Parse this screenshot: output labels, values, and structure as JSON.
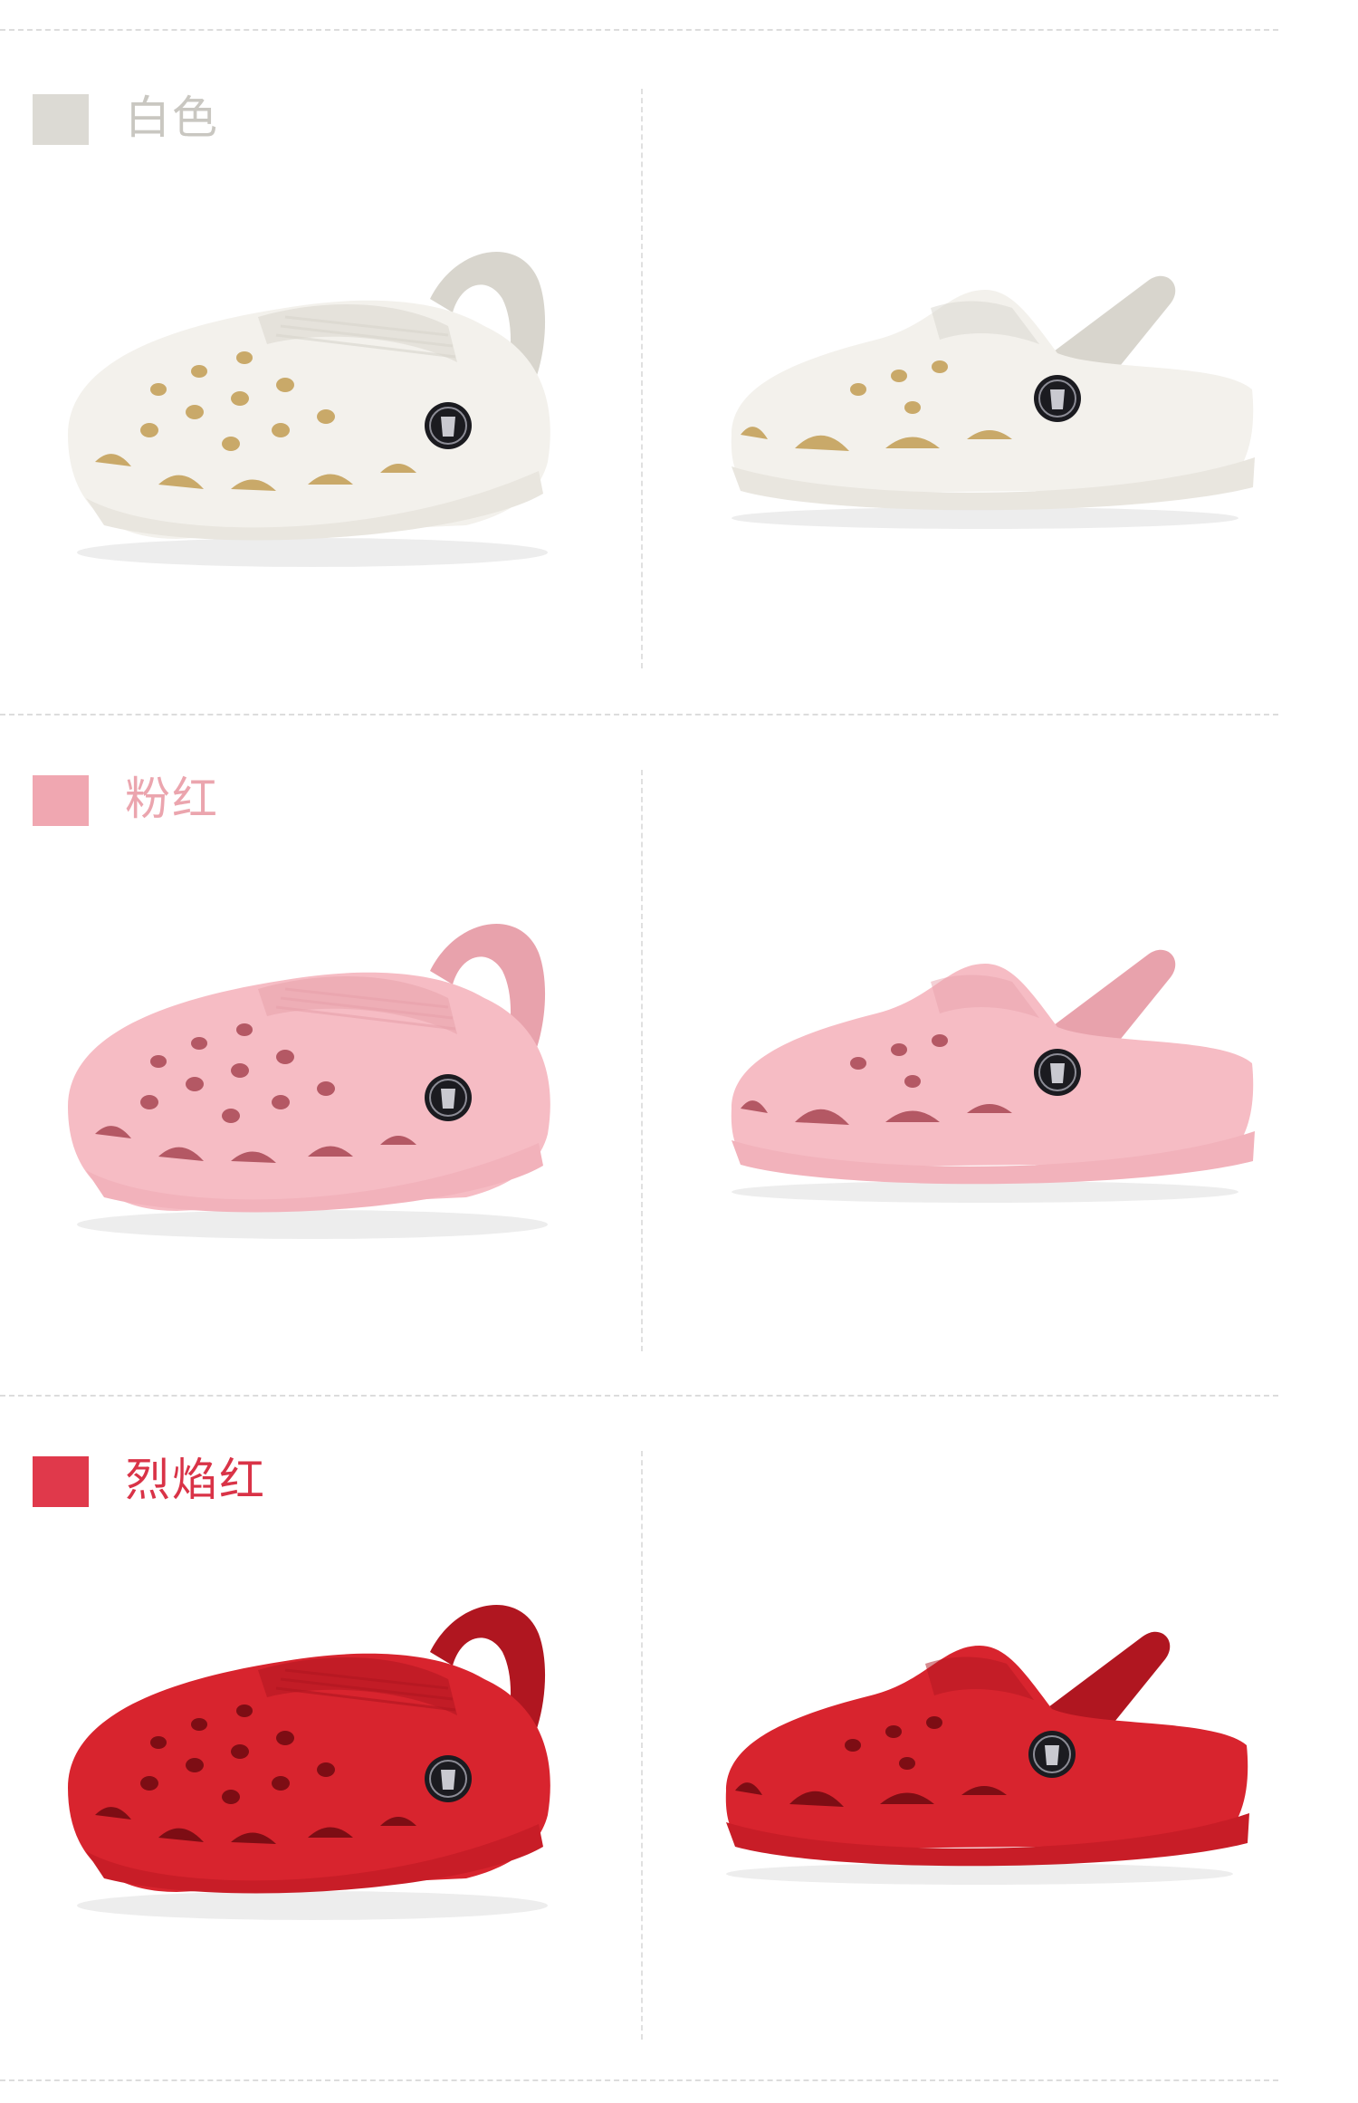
{
  "colors": [
    {
      "name": "白色",
      "swatch": "#dcdad4",
      "label_color": "#c9c7c1",
      "shoe": {
        "base": "#f3f1ec",
        "shade": "#d8d5cd",
        "hole": "#c9a969",
        "sole": "#e9e6df"
      }
    },
    {
      "name": "粉红",
      "swatch": "#f0a7b1",
      "label_color": "#eba5ae",
      "shoe": {
        "base": "#f6bcc4",
        "shade": "#e8a2ac",
        "hole": "#b45864",
        "sole": "#f2b2bb"
      }
    },
    {
      "name": "烈焰红",
      "swatch": "#e0394b",
      "label_color": "#d93347",
      "shoe": {
        "base": "#d8242e",
        "shade": "#b01620",
        "hole": "#7d0d14",
        "sole": "#c81d27"
      }
    }
  ]
}
